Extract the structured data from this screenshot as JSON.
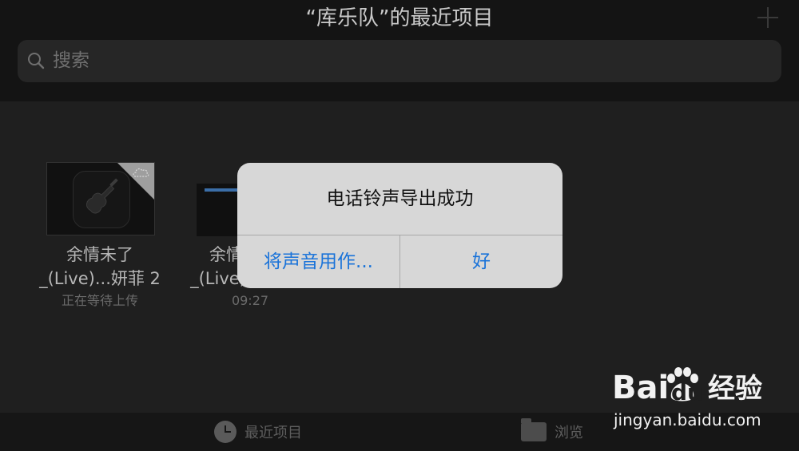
{
  "header": {
    "title": "“库乐队”的最近项目",
    "add_label": "+"
  },
  "search": {
    "placeholder": "搜索"
  },
  "items": [
    {
      "name_line1": "余情未了",
      "name_line2": "_(Live)...妍菲 2",
      "subtitle": "正在等待上传"
    },
    {
      "name_line1": "余情",
      "name_line2": "_(Live)",
      "subtitle": "09:27"
    }
  ],
  "alert": {
    "title": "电话铃声导出成功",
    "left_button": "将声音用作...",
    "right_button": "好"
  },
  "tabbar": {
    "recent_label": "最近项目",
    "browse_label": "浏览"
  },
  "watermark": {
    "brand_left": "Bai",
    "brand_right": "du",
    "product": "经验",
    "url": "jingyan.baidu.com"
  },
  "colors": {
    "accent": "#1a73d9",
    "alert_bg": "#d7d7d7",
    "background": "#1f1f1f"
  }
}
